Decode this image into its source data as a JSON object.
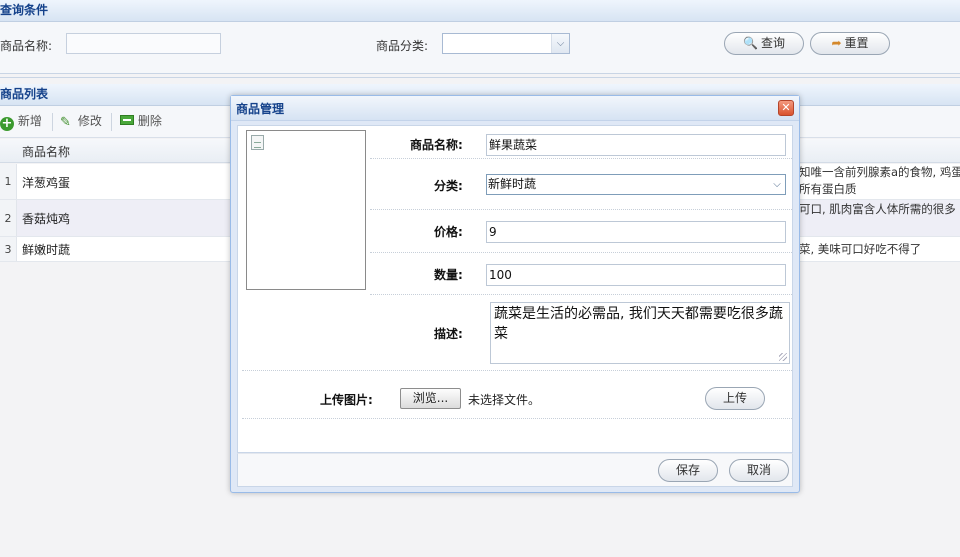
{
  "query": {
    "title": "查询条件",
    "name_label": "商品名称:",
    "category_label": "商品分类:",
    "search_btn": "查询",
    "reset_btn": "重置"
  },
  "list": {
    "title": "商品列表",
    "toolbar": {
      "add": "新增",
      "edit": "修改",
      "delete": "删除"
    },
    "column_name": "商品名称",
    "rows": [
      {
        "num": "1",
        "name": "洋葱鸡蛋",
        "desc1": "知唯一含前列腺素a的食物, 鸡蛋",
        "desc2": "所有蛋白质"
      },
      {
        "num": "2",
        "name": "香菇炖鸡",
        "desc1": "可口, 肌肉富含人体所需的很多",
        "desc2": ""
      },
      {
        "num": "3",
        "name": "鲜嫩时蔬",
        "desc1": "菜, 美味可口好吃不得了",
        "desc2": ""
      }
    ]
  },
  "dialog": {
    "title": "商品管理",
    "close": "✕",
    "fields": {
      "name_label": "商品名称:",
      "name_value": "鲜果蔬菜",
      "category_label": "分类:",
      "category_value": "新鲜时蔬",
      "price_label": "价格:",
      "price_value": "9",
      "quantity_label": "数量:",
      "quantity_value": "100",
      "desc_label": "描述:",
      "desc_value": "蔬菜是生活的必需品, 我们天天都需要吃很多蔬菜",
      "upload_label": "上传图片:",
      "browse_btn": "浏览...",
      "file_status": "未选择文件。",
      "upload_btn": "上传"
    },
    "footer": {
      "save": "保存",
      "cancel": "取消"
    }
  }
}
